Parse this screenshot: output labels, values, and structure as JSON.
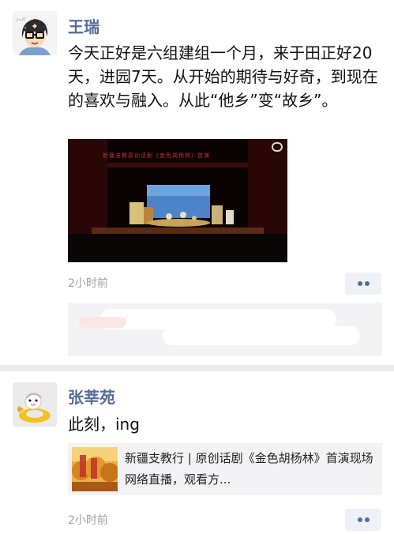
{
  "posts": [
    {
      "author": "王瑞",
      "avatar_icon": "cartoon-glasses-avatar-icon",
      "text": "今天正好是六组建组一个月，来于田正好20天，进园7天。从开始的期待与好奇，到现在的喜欢与融入。从此“他乡”变“故乡”。",
      "video": {
        "caption": "新疆支教原创话剧《金色胡杨林》首演"
      },
      "timestamp": "2小时前"
    },
    {
      "author": "张莘苑",
      "avatar_icon": "duck-float-avatar-icon",
      "text": "此刻，ing",
      "share": {
        "title": "新疆支教行 | 原创话剧《金色胡杨林》首演现场网络直播，观看方..."
      },
      "timestamp": "2小时前"
    }
  ],
  "colors": {
    "name": "#576b95",
    "timestamp": "#a0a0a0",
    "divider": "#ededed",
    "card_bg": "#f3f3f5"
  }
}
